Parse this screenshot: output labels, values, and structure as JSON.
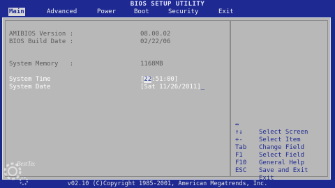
{
  "title": "BIOS SETUP UTILITY",
  "menu": [
    {
      "label": "Main",
      "active": true
    },
    {
      "label": "Advanced",
      "active": false
    },
    {
      "label": "Power",
      "active": false
    },
    {
      "label": "Boot",
      "active": false
    },
    {
      "label": "Security",
      "active": false
    },
    {
      "label": "Exit",
      "active": false
    }
  ],
  "info": {
    "amibios_version_label": "AMIBIOS Version :",
    "amibios_version_value": "08.00.02",
    "build_date_label": "BIOS Build Date :",
    "build_date_value": "02/22/06",
    "memory_label": "System Memory   :",
    "memory_value": "1168MB"
  },
  "settings": {
    "time_label": "System Time",
    "time_bracket_open": "[",
    "time_hour": "22",
    "time_rest": ":51:00]",
    "date_label": "System Date",
    "date_value": "[Sat 11/26/2011]",
    "date_cursor": "_"
  },
  "help": [
    {
      "key": "↔",
      "desc": "Select Screen"
    },
    {
      "key": "↑↓",
      "desc": "Select Item"
    },
    {
      "key": "+-",
      "desc": "Change Field"
    },
    {
      "key": "Tab",
      "desc": "Select Field"
    },
    {
      "key": "F1",
      "desc": "General Help"
    },
    {
      "key": "F10",
      "desc": "Save and Exit"
    },
    {
      "key": "ESC",
      "desc": "Exit"
    }
  ],
  "footer": "v02.10 (C)Copyright 1985-2001, American Megatrends, Inc.",
  "logo_text": "BestTech",
  "colors": {
    "bios_blue": "#1e2a92",
    "panel_gray": "#b8b8b8",
    "text_white": "#ffffff",
    "text_gray": "#5a5a5a"
  }
}
